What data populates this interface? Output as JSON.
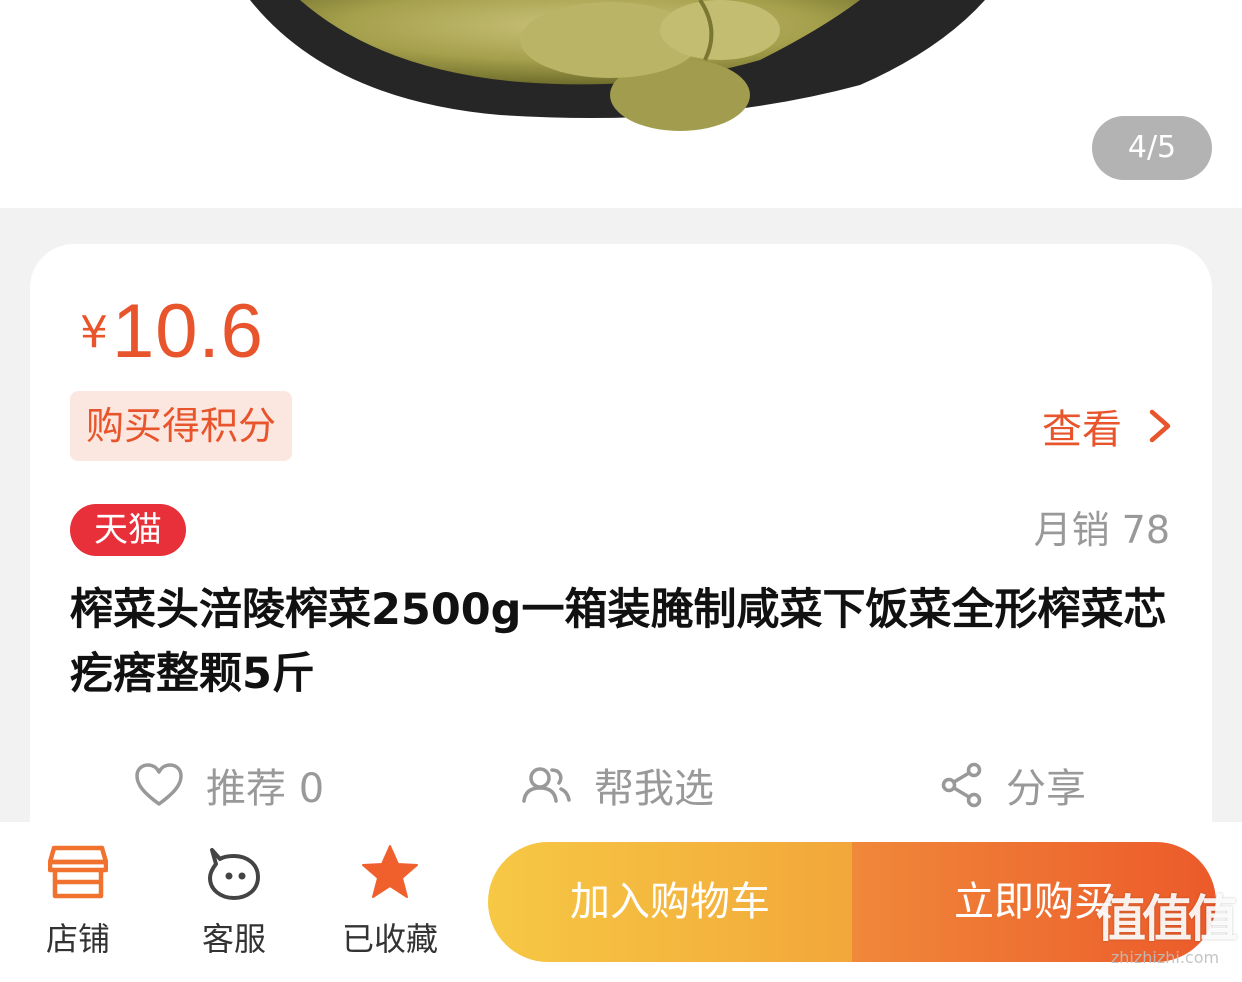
{
  "gallery": {
    "page_indicator": "4/5"
  },
  "product": {
    "currency": "¥",
    "price": "10.6",
    "points_tag": "购买得积分",
    "view_label": "查看",
    "badge": "天猫",
    "monthly_sales": "月销 78",
    "title": "榨菜头涪陵榨菜2500g一箱装腌制咸菜下饭菜全形榨菜芯疙瘩整颗5斤"
  },
  "actions": {
    "like_label": "推荐 0",
    "help_choose_label": "帮我选",
    "share_label": "分享"
  },
  "bottom_bar": {
    "store_label": "店铺",
    "service_label": "客服",
    "favorite_label": "已收藏",
    "add_cart_label": "加入购物车",
    "buy_now_label": "立即购买"
  },
  "watermark": {
    "logo": "值值值",
    "domain": "zhizhizhi.com"
  },
  "colors": {
    "accent": "#e8542b",
    "tmall_red": "#e8303a",
    "muted": "#999999"
  },
  "icons": [
    "store-icon",
    "service-icon",
    "star-icon",
    "heart-icon",
    "people-icon",
    "share-icon",
    "chevron-right-icon"
  ]
}
